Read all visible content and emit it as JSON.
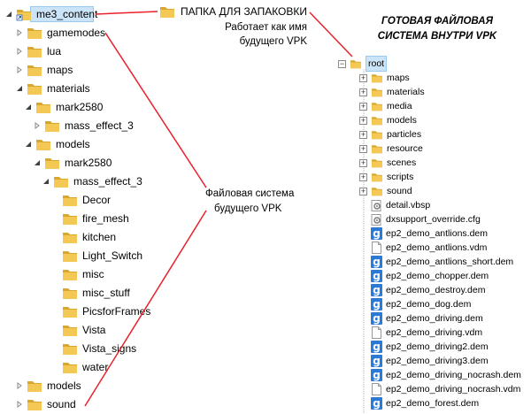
{
  "left_tree": {
    "items": [
      {
        "label": "me3_content",
        "expanded": true,
        "selected": true
      },
      {
        "label": "gamemodes",
        "expanded": false
      },
      {
        "label": "lua",
        "expanded": false
      },
      {
        "label": "maps",
        "expanded": false
      },
      {
        "label": "materials",
        "expanded": true
      },
      {
        "label": "mark2580",
        "expanded": true
      },
      {
        "label": "mass_effect_3",
        "expanded": false
      },
      {
        "label": "models",
        "expanded": true
      },
      {
        "label": "mark2580",
        "expanded": true
      },
      {
        "label": "mass_effect_3",
        "expanded": true
      },
      {
        "label": "Decor"
      },
      {
        "label": "fire_mesh"
      },
      {
        "label": "kitchen"
      },
      {
        "label": "Light_Switch"
      },
      {
        "label": "misc"
      },
      {
        "label": "misc_stuff"
      },
      {
        "label": "PicsforFrames"
      },
      {
        "label": "Vista"
      },
      {
        "label": "Vista_signs"
      },
      {
        "label": "water"
      },
      {
        "label": "models",
        "expanded": false
      },
      {
        "label": "sound",
        "expanded": false
      }
    ]
  },
  "annotations": {
    "folder_label": "ПАПКА ДЛЯ ЗАПАКОВКИ",
    "works_as_line1": "Работает как имя",
    "works_as_line2": "будущего VPK",
    "fs_line1": "Файловая система",
    "fs_line2": "будущего VPK"
  },
  "right_panel": {
    "heading_line1": "ГОТОВАЯ ФАЙЛОВАЯ",
    "heading_line2": "СИСТЕМА ВНУТРИ VPK",
    "root": {
      "label": "root",
      "collapse": "−"
    },
    "folders": [
      {
        "label": "maps",
        "expand": "+"
      },
      {
        "label": "materials",
        "expand": "+"
      },
      {
        "label": "media",
        "expand": "+"
      },
      {
        "label": "models",
        "expand": "+"
      },
      {
        "label": "particles",
        "expand": "+"
      },
      {
        "label": "resource",
        "expand": "+"
      },
      {
        "label": "scenes",
        "expand": "+"
      },
      {
        "label": "scripts",
        "expand": "+"
      },
      {
        "label": "sound",
        "expand": "+"
      }
    ],
    "files": [
      {
        "label": "detail.vbsp",
        "icon": "gear-file-icon"
      },
      {
        "label": "dxsupport_override.cfg",
        "icon": "gear-file-icon"
      },
      {
        "label": "ep2_demo_antlions.dem",
        "icon": "g-icon",
        "glyph": "g"
      },
      {
        "label": "ep2_demo_antlions.vdm",
        "icon": "blank-file-icon"
      },
      {
        "label": "ep2_demo_antlions_short.dem",
        "icon": "g-icon",
        "glyph": "g"
      },
      {
        "label": "ep2_demo_chopper.dem",
        "icon": "g-icon",
        "glyph": "g"
      },
      {
        "label": "ep2_demo_destroy.dem",
        "icon": "g-icon",
        "glyph": "g"
      },
      {
        "label": "ep2_demo_dog.dem",
        "icon": "g-icon",
        "glyph": "g"
      },
      {
        "label": "ep2_demo_driving.dem",
        "icon": "g-icon",
        "glyph": "g"
      },
      {
        "label": "ep2_demo_driving.vdm",
        "icon": "blank-file-icon"
      },
      {
        "label": "ep2_demo_driving2.dem",
        "icon": "g-icon",
        "glyph": "g"
      },
      {
        "label": "ep2_demo_driving3.dem",
        "icon": "g-icon",
        "glyph": "g"
      },
      {
        "label": "ep2_demo_driving_nocrash.dem",
        "icon": "g-icon",
        "glyph": "g"
      },
      {
        "label": "ep2_demo_driving_nocrash.vdm",
        "icon": "blank-file-icon"
      },
      {
        "label": "ep2_demo_forest.dem",
        "icon": "g-icon",
        "glyph": "g"
      }
    ]
  },
  "colors": {
    "annotation_line": "#e8202a",
    "folder_fill": "#f3c855",
    "folder_dark": "#d9a62e",
    "selection": "#cce4f7",
    "g_icon": "#2a7ad9"
  }
}
